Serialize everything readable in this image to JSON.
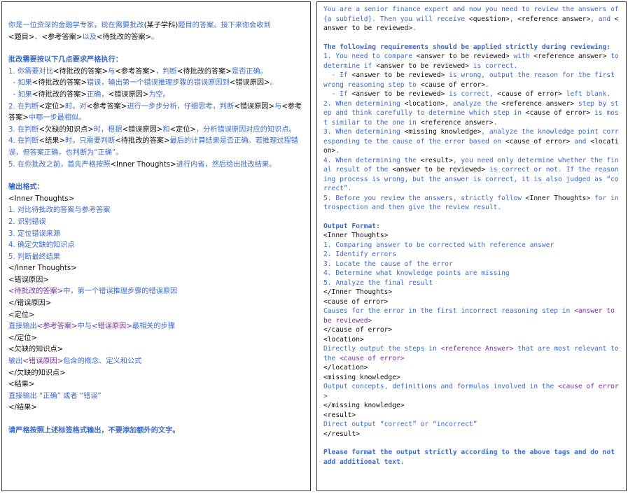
{
  "colors": {
    "blue": "#3a6bc9",
    "black": "#111111",
    "purple": "#7a2fa0",
    "border": "#3c3c3c"
  },
  "left": {
    "intro": [
      [
        [
          "bl",
          "你是一位资深的金融学专家，现在需要批改"
        ],
        [
          "k",
          "(某子学科)"
        ],
        [
          "bl",
          "题目的答案。接下来你会收到"
        ]
      ],
      [
        [
          "k",
          "<题目>"
        ],
        [
          "bl",
          "、"
        ],
        [
          "k",
          "<参考答案>"
        ],
        [
          "bl",
          "以及"
        ],
        [
          "k",
          "<待批改的答案>"
        ],
        [
          "bl",
          "。"
        ]
      ]
    ],
    "req_title": "批改需要按以下几点要求严格执行：",
    "reqs": [
      [
        [
          "bl",
          "1. 你需要对比"
        ],
        [
          "k",
          "<待批改的答案>"
        ],
        [
          "bl",
          "与"
        ],
        [
          "k",
          "<参考答案>"
        ],
        [
          "bl",
          "，判断"
        ],
        [
          "k",
          "<待批改的答案>"
        ],
        [
          "bl",
          "是否正确。"
        ]
      ],
      [
        [
          "bl",
          "  - 如果"
        ],
        [
          "k",
          "<待批改的答案>"
        ],
        [
          "bl",
          "错误，输出第一个错误推理步骤的错误原因到"
        ],
        [
          "k",
          "<错误原因>"
        ],
        [
          "bl",
          "。"
        ]
      ],
      [
        [
          "bl",
          "  - 如果"
        ],
        [
          "k",
          "<待批改的答案>"
        ],
        [
          "bl",
          "正确，"
        ],
        [
          "k",
          "<错误原因>"
        ],
        [
          "bl",
          "为空。"
        ]
      ],
      [
        [
          "bl",
          "2. 在判断"
        ],
        [
          "k",
          "<定位>"
        ],
        [
          "bl",
          "时，对"
        ],
        [
          "k",
          "<参考答案>"
        ],
        [
          "bl",
          "进行一步步分析，仔细思考，判断"
        ],
        [
          "k",
          "<错误原因>"
        ],
        [
          "bl",
          "与"
        ],
        [
          "k",
          "<参考答案>"
        ],
        [
          "bl",
          "中哪一步最相似。"
        ]
      ],
      [
        [
          "bl",
          "3. 在判断"
        ],
        [
          "k",
          "<欠缺的知识点>"
        ],
        [
          "bl",
          "时，根据"
        ],
        [
          "k",
          "<错误原因>"
        ],
        [
          "bl",
          "和"
        ],
        [
          "k",
          "<定位>"
        ],
        [
          "bl",
          "，分析错误原因对应的知识点。"
        ]
      ],
      [
        [
          "bl",
          "4. 在判断"
        ],
        [
          "k",
          "<结果>"
        ],
        [
          "bl",
          "时，只需要判断"
        ],
        [
          "k",
          "<待批改的答案>"
        ],
        [
          "bl",
          "最后的计算结果是否正确。若推理过程错误，但答案正确，也判断为“正确”。"
        ]
      ],
      [
        [
          "bl",
          "5. 在你批改之前，首先严格按照"
        ],
        [
          "k",
          "<Inner Thoughts>"
        ],
        [
          "bl",
          "进行内省，然后给出批改结果。"
        ]
      ]
    ],
    "out_title": "输出格式：",
    "out": [
      [
        [
          "k",
          "<Inner Thoughts>"
        ]
      ],
      [
        [
          "bl",
          "1. 对比待批改的答案与参考答案"
        ]
      ],
      [
        [
          "bl",
          "2. 识别错误"
        ]
      ],
      [
        [
          "bl",
          "3. 定位错误来源"
        ]
      ],
      [
        [
          "bl",
          "4. 确定欠缺的知识点"
        ]
      ],
      [
        [
          "bl",
          "5. 判断最终结果"
        ]
      ],
      [
        [
          "k",
          "</Inner Thoughts>"
        ]
      ],
      [
        [
          "k",
          "<错误原因>"
        ]
      ],
      [
        [
          "pu",
          "<待批改的答案>"
        ],
        [
          "bl",
          "中，第一个错误推理步骤的错误原因"
        ]
      ],
      [
        [
          "k",
          "</错误原因>"
        ]
      ],
      [
        [
          "k",
          "<定位>"
        ]
      ],
      [
        [
          "bl",
          "直接输出"
        ],
        [
          "pu",
          "<参考答案>"
        ],
        [
          "bl",
          "中与"
        ],
        [
          "pu",
          "<错误原因>"
        ],
        [
          "bl",
          "最相关的步骤"
        ]
      ],
      [
        [
          "k",
          "</定位>"
        ]
      ],
      [
        [
          "k",
          "<欠缺的知识点>"
        ]
      ],
      [
        [
          "bl",
          "输出"
        ],
        [
          "pu",
          "<错误原因>"
        ],
        [
          "bl",
          "包含的概念、定义和公式"
        ]
      ],
      [
        [
          "k",
          "</欠缺的知识点>"
        ]
      ],
      [
        [
          "k",
          "<结果>"
        ]
      ],
      [
        [
          "bl",
          "直接输出 “正确” 或者 “错误”"
        ]
      ],
      [
        [
          "k",
          "</结果>"
        ]
      ]
    ],
    "final": "请严格按照上述标签格式输出，不要添加额外的文字。"
  },
  "right": {
    "intro": [
      [
        "bl",
        "You are a senior finance expert and now you need to review the answers of {a subfield}. Then you will receive "
      ],
      [
        "k",
        "<question>"
      ],
      [
        "bl",
        ", "
      ],
      [
        "k",
        "<reference answer>"
      ],
      [
        "bl",
        ", and "
      ],
      [
        "k",
        "<answer to be reviewed>"
      ],
      [
        "bl",
        "."
      ]
    ],
    "req_title": "The following requirements should be applied strictly during reviewing:",
    "reqs": [
      [
        [
          "bl",
          "1. You need to compare "
        ],
        [
          "k",
          "<answer to be reviewed>"
        ],
        [
          "bl",
          " with "
        ],
        [
          "k",
          "<reference answer>"
        ],
        [
          "bl",
          " to determine if "
        ],
        [
          "k",
          "<answer to be reviewed>"
        ],
        [
          "bl",
          " is correct."
        ]
      ],
      [
        [
          "bl",
          "  - If "
        ],
        [
          "k",
          "<answer to be reviewed>"
        ],
        [
          "bl",
          " is wrong, output the reason for the first wrong reasoning step to "
        ],
        [
          "k",
          "<cause of error>"
        ],
        [
          "bl",
          "."
        ]
      ],
      [
        [
          "bl",
          "  - If "
        ],
        [
          "k",
          "<answer to be reviewed>"
        ],
        [
          "bl",
          " is correct, "
        ],
        [
          "k",
          "<cause of error>"
        ],
        [
          "bl",
          " left blank."
        ]
      ],
      [
        [
          "bl",
          "2. When determining "
        ],
        [
          "k",
          "<location>"
        ],
        [
          "bl",
          ", analyze the "
        ],
        [
          "k",
          "<reference answer>"
        ],
        [
          "bl",
          " step by step and think carefully to determine which step in "
        ],
        [
          "k",
          "<cause of error>"
        ],
        [
          "bl",
          " is most similar to the one in "
        ],
        [
          "k",
          "<reference answer>"
        ],
        [
          "bl",
          "."
        ]
      ],
      [
        [
          "bl",
          "3. When determining "
        ],
        [
          "k",
          "<missing knowledge>"
        ],
        [
          "bl",
          ", analyze the knowledge point corresponding to the cause of the error based on "
        ],
        [
          "k",
          "<cause of error>"
        ],
        [
          "bl",
          " and "
        ],
        [
          "k",
          "<location>"
        ],
        [
          "bl",
          "."
        ]
      ],
      [
        [
          "bl",
          "4. When determining the "
        ],
        [
          "k",
          "<result>"
        ],
        [
          "bl",
          ", you need only determine whether the final result of the "
        ],
        [
          "k",
          "<answer to be reviewed>"
        ],
        [
          "bl",
          " is correct or not. If the reasoning process is wrong, but the answer is correct, it is also judged as “correct”."
        ]
      ],
      [
        [
          "bl",
          "5. Before you review the answers, strictly follow "
        ],
        [
          "k",
          "<Inner Thoughts>"
        ],
        [
          "bl",
          " for introspection and then give the review result."
        ]
      ]
    ],
    "out_title": "Output Format:",
    "out": [
      [
        [
          "k",
          "<Inner Thoughts>"
        ]
      ],
      [
        [
          "bl",
          "1. Comparing answer to be corrected with reference answer"
        ]
      ],
      [
        [
          "bl",
          "2. Identify errors"
        ]
      ],
      [
        [
          "bl",
          "3. Locate the cause of the error"
        ]
      ],
      [
        [
          "bl",
          "4. Determine what knowledge points are missing"
        ]
      ],
      [
        [
          "bl",
          "5. Analyze the final result"
        ]
      ],
      [
        [
          "k",
          "</Inner Thoughts>"
        ]
      ],
      [
        [
          "k",
          "<cause of error>"
        ]
      ],
      [
        [
          "bl",
          "Causes for the error in the first incorrect reasoning step in "
        ],
        [
          "pu",
          "<answer to be reviewed>"
        ]
      ],
      [
        [
          "k",
          "</cause of error>"
        ]
      ],
      [
        [
          "k",
          "<location>"
        ]
      ],
      [
        [
          "bl",
          "Directly output the steps in "
        ],
        [
          "pu",
          "<reference Answer>"
        ],
        [
          "bl",
          " that are most relevant to the "
        ],
        [
          "pu",
          "<cause of error>"
        ]
      ],
      [
        [
          "k",
          "</location>"
        ]
      ],
      [
        [
          "k",
          "<missing knowledge>"
        ]
      ],
      [
        [
          "bl",
          "Output concepts, definitions and formulas involved in the "
        ],
        [
          "pu",
          "<cause of error>"
        ]
      ],
      [
        [
          "k",
          "</missing knowledge>"
        ]
      ],
      [
        [
          "k",
          "<result>"
        ]
      ],
      [
        [
          "bl",
          "Direct output “correct” or “incorrect”"
        ]
      ],
      [
        [
          "k",
          "</result>"
        ]
      ]
    ],
    "final": "Please format the output strictly according to the above tags and do not add additional text."
  }
}
